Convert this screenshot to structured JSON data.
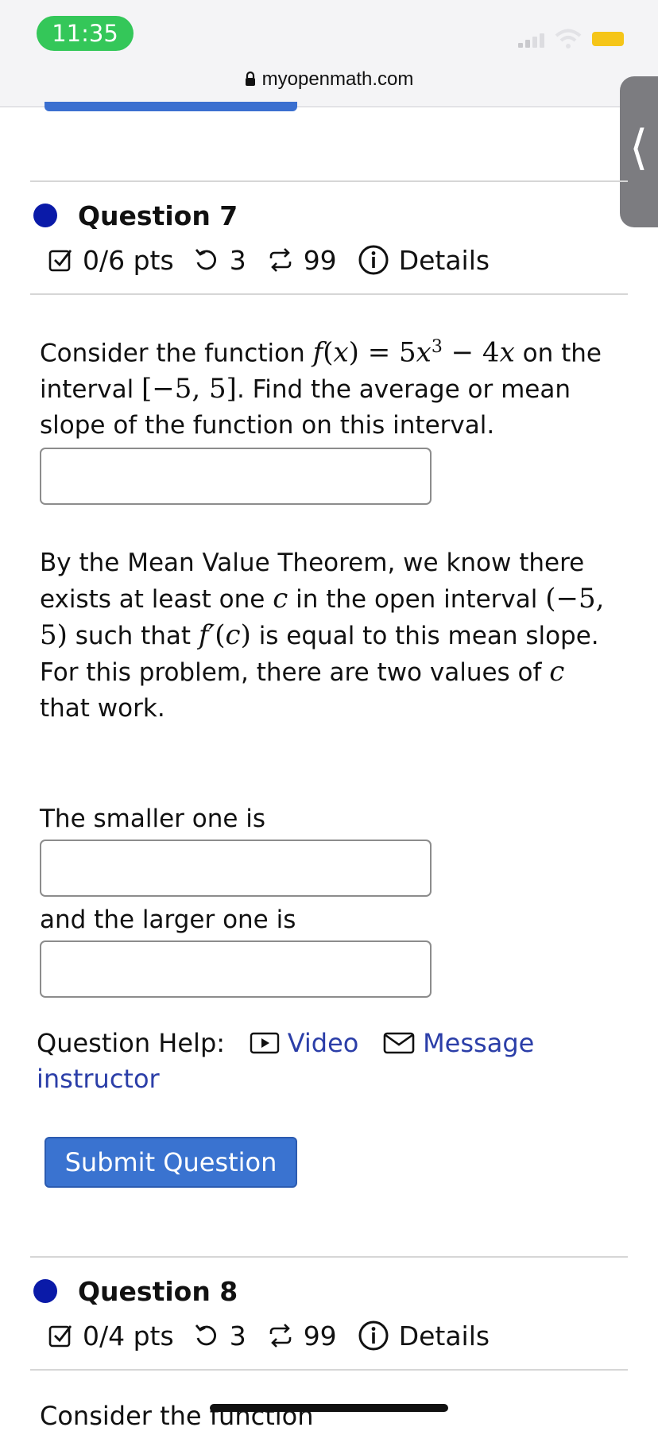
{
  "status_bar": {
    "time": "11:35",
    "url": "myopenmath.com"
  },
  "side_handle_glyph": "⟨",
  "questions": [
    {
      "title": "Question 7",
      "points": "0/6 pts",
      "attempts": "3",
      "tries": "99",
      "details": "Details"
    },
    {
      "title": "Question 8",
      "points": "0/4 pts",
      "attempts": "3",
      "tries": "99",
      "details": "Details"
    }
  ],
  "q7": {
    "p1_a": "Consider the function",
    "p1_b": "on",
    "p1_c": "the interval",
    "p1_d": ". Find the average or mean slope of the function on this interval.",
    "p2_a": "By the Mean Value Theorem, we know there exists at least one",
    "p2_b": "in the open interval",
    "p2_c": "such that",
    "p2_d": "is equal to this mean slope.",
    "p3_a": "For this problem, there are two values of",
    "p3_b": "that work.",
    "smaller_label": "The smaller one is",
    "larger_label": "and the larger one is",
    "answers": {
      "mean_slope": "",
      "smaller": "",
      "larger": ""
    }
  },
  "help": {
    "label": "Question Help:",
    "video": "Video",
    "message": "Message instructor"
  },
  "submit_label": "Submit Question",
  "q8_cutoff_text": "Consider the function",
  "colors": {
    "accent": "#3a73d0",
    "link": "#2b3ea8",
    "dot": "#0a1aa8",
    "time_pill": "#34c759",
    "battery": "#f5c518"
  }
}
